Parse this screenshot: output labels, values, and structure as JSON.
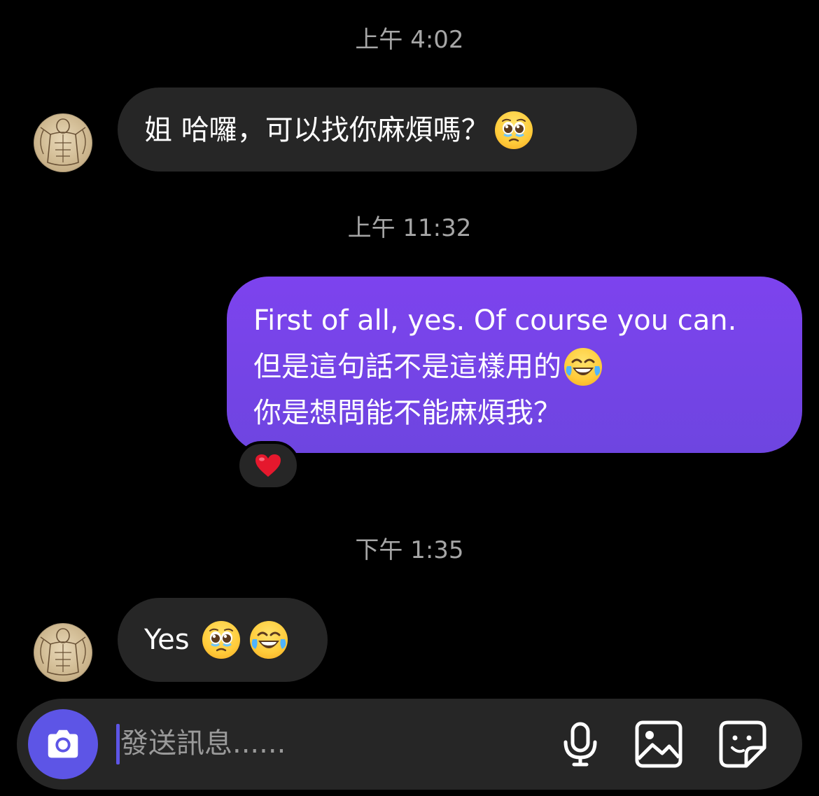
{
  "thread": {
    "timestamps": [
      "上午 4:02",
      "上午 11:32",
      "下午 1:35"
    ],
    "messages": [
      {
        "direction": "incoming",
        "text": "姐 哈囉，可以找你麻煩嗎？",
        "emojis": [
          "pleading-face-emoji"
        ]
      },
      {
        "direction": "outgoing",
        "lines": [
          "First of all, yes. Of course you can.",
          "但是這句話不是這樣用的",
          "你是想問能不能麻煩我？"
        ],
        "emojis": [
          "face-with-tears-of-joy-emoji"
        ],
        "reaction": "red-heart-emoji"
      },
      {
        "direction": "incoming",
        "text": "Yes",
        "emojis": [
          "pleading-face-emoji",
          "face-with-tears-of-joy-emoji"
        ]
      }
    ]
  },
  "composer": {
    "placeholder": "發送訊息......",
    "buttons": [
      "camera-icon",
      "microphone-icon",
      "gallery-icon",
      "sticker-icon"
    ]
  },
  "colors": {
    "background": "#000000",
    "incoming_bubble": "#262626",
    "outgoing_bubble": "#7544e8",
    "camera_button": "#5d55e6",
    "timestamp": "#a6a6a6",
    "placeholder": "#9a9a9a"
  }
}
